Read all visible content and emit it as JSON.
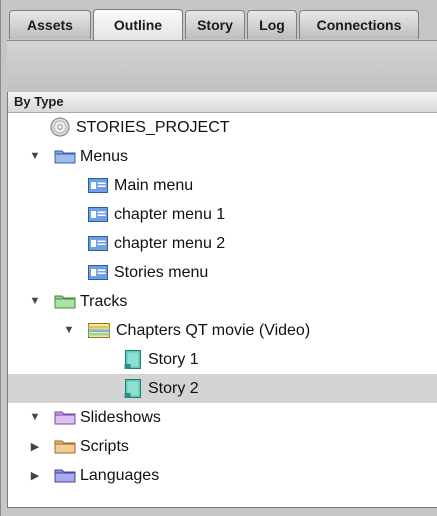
{
  "tabs": [
    {
      "label": "Assets",
      "active": false
    },
    {
      "label": "Outline",
      "active": true
    },
    {
      "label": "Story",
      "active": false
    },
    {
      "label": "Log",
      "active": false
    },
    {
      "label": "Connections",
      "active": false
    }
  ],
  "section": {
    "header": "By Type"
  },
  "tree": {
    "project": "STORIES_PROJECT",
    "menus": {
      "label": "Menus",
      "items": [
        "Main menu",
        "chapter menu 1",
        "chapter menu 2",
        "Stories menu"
      ]
    },
    "tracks": {
      "label": "Tracks",
      "track": {
        "label": "Chapters QT movie (Video)",
        "stories": [
          "Story 1",
          "Story 2"
        ]
      }
    },
    "slideshows": "Slideshows",
    "scripts": "Scripts",
    "languages": "Languages"
  },
  "colors": {
    "folder_blue": "#7fa6e6",
    "folder_green": "#8fd08a",
    "folder_purple": "#c9a4e8",
    "folder_orange": "#e9b878",
    "selection": "#d4d4d4"
  }
}
